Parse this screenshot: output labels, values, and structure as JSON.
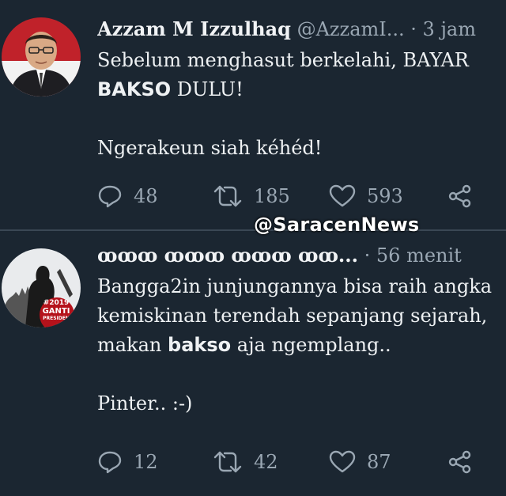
{
  "tweets": [
    {
      "name": "Azzam M Izzulhaq",
      "handle": "@AzzamI...",
      "time": "3 jam",
      "body": {
        "line1": "Sebelum menghasut berkelahi, BAYAR",
        "line2_bold": "BAKSO",
        "line2_rest": " DULU!",
        "line3": "Ngerakeun siah kéhéd!"
      },
      "replies": "48",
      "retweets": "185",
      "likes": "593"
    },
    {
      "name": "ꝏꝏꝏ ꝏꝏꝏ ꝏꝏꝏ ꝏꝏ...",
      "time": "56 menit",
      "avatar_badge": {
        "year": "#2019",
        "line1": "GANTI",
        "line2": "PRESIDEN"
      },
      "body": {
        "line1": "Bangga2in junjungannya bisa raih angka",
        "line2": "kemiskinan terendah sepanjang sejarah,",
        "line3_pre": "makan ",
        "line3_bold": "bakso",
        "line3_rest": " aja ngemplang..",
        "line4": "Pinter..  :-)"
      },
      "replies": "12",
      "retweets": "42",
      "likes": "87"
    }
  ],
  "watermark": "@SaracenNews",
  "icons": {
    "reply": "reply-icon",
    "retweet": "retweet-icon",
    "like": "heart-icon",
    "share": "share-icon"
  },
  "colors": {
    "background": "#1b2631",
    "muted": "#9aa7b3",
    "text": "#eef1f3"
  }
}
